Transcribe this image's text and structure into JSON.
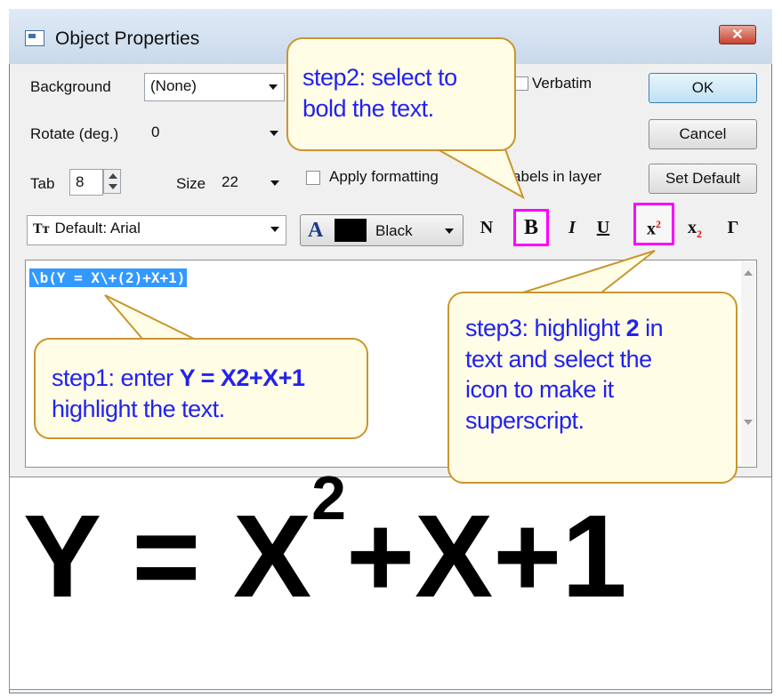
{
  "window": {
    "title": "Object Properties",
    "close": "✕"
  },
  "form": {
    "background_label": "Background",
    "background_value": "(None)",
    "rotate_label": "Rotate (deg.)",
    "rotate_value": "0",
    "tab_label": "Tab",
    "tab_value": "8",
    "size_label": "Size",
    "size_value": "22",
    "verbatim_label": "Verbatim",
    "apply_label": "Apply formatting",
    "apply_suffix": "ll labels in layer",
    "font_value": "Default: Arial",
    "color_value": "Black"
  },
  "buttons": {
    "ok": "OK",
    "cancel": "Cancel",
    "set_default": "Set Default"
  },
  "format_buttons": {
    "normal": "N",
    "bold": "B",
    "italic": "I",
    "underline": "U",
    "superscript_base": "x",
    "superscript_exp": "2",
    "subscript_base": "x",
    "subscript_exp": "2",
    "greek": "Γ"
  },
  "editor": {
    "text": "\\b(Y = X\\+(2)+X+1)"
  },
  "preview": {
    "base": "Y = X",
    "exponent": "2",
    "rest": "+X+1"
  },
  "callouts": {
    "step1": {
      "prefix": "step1: enter ",
      "bold": "Y = X2+X+1",
      "line2": "highlight the text."
    },
    "step2": {
      "line1": "step2: select to",
      "line2": "bold the text."
    },
    "step3": {
      "line1a": "step3: highlight ",
      "bold": "2",
      "line1b": " in",
      "line2": "text and select the",
      "line3": "icon to make it",
      "line4": "superscript."
    }
  },
  "colors": {
    "callout_text": "#2222ee",
    "highlight_box": "#ff00ff",
    "selection": "#3399ff",
    "callout_border": "#c8962e"
  }
}
